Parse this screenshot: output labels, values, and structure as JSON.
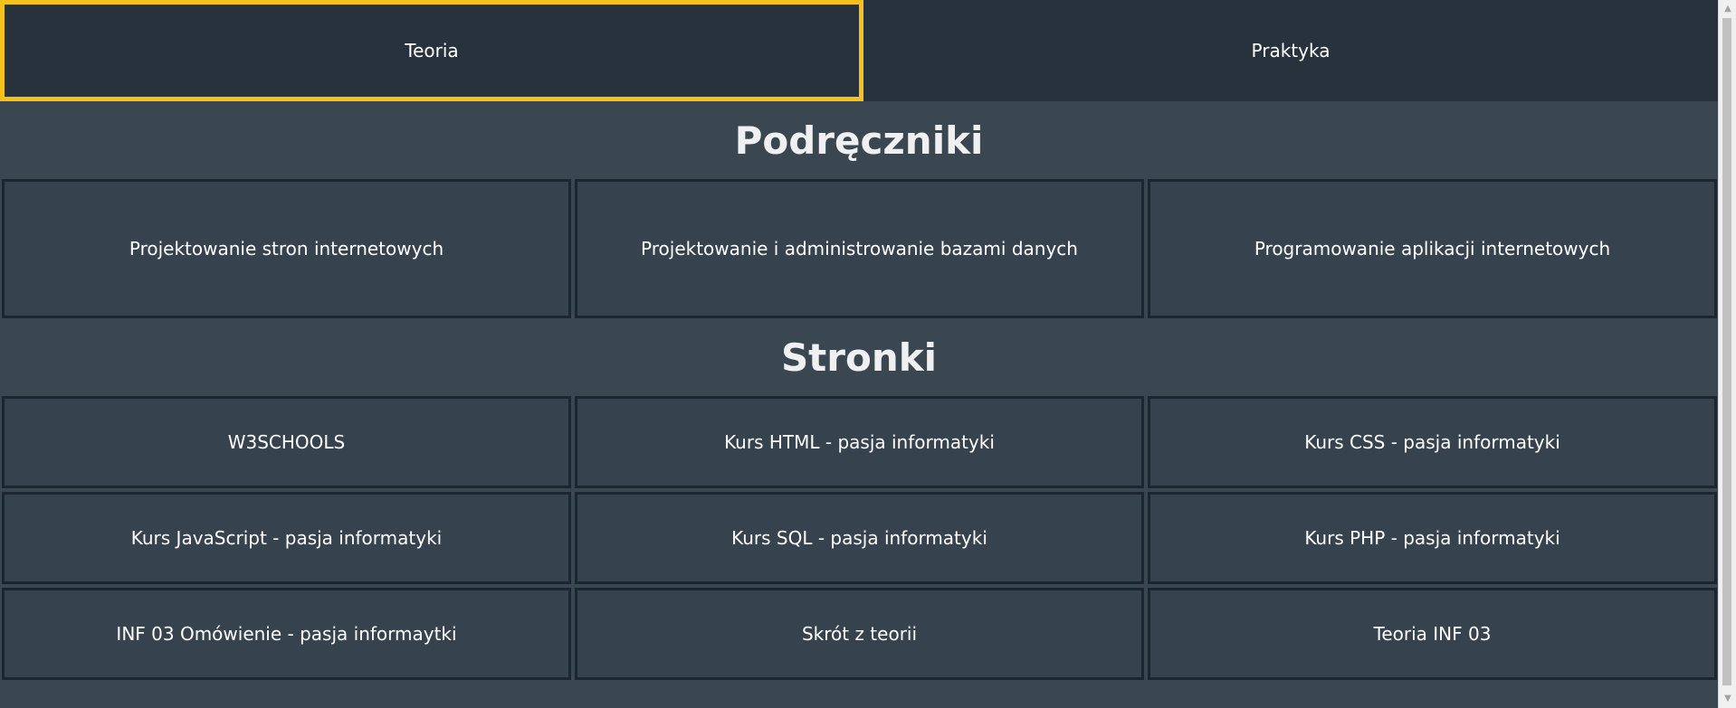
{
  "nav": {
    "tabs": [
      {
        "label": "Teoria",
        "active": true
      },
      {
        "label": "Praktyka",
        "active": false
      }
    ]
  },
  "sections": [
    {
      "title": "Podręczniki",
      "cards": [
        "Projektowanie stron internetowych",
        "Projektowanie i administrowanie bazami danych",
        "Programowanie aplikacji internetowych"
      ]
    },
    {
      "title": "Stronki",
      "cards": [
        "W3SCHOOLS",
        "Kurs HTML - pasja informatyki",
        "Kurs CSS - pasja informatyki",
        "Kurs JavaScript - pasja informatyki",
        "Kurs SQL - pasja informatyki",
        "Kurs PHP - pasja informatyki",
        "INF 03 Omówienie - pasja informaytki",
        "Skrót z teorii",
        "Teoria INF 03"
      ]
    }
  ],
  "colors": {
    "page_bg": "#3a4650",
    "nav_bg": "#27323d",
    "card_bg": "#36424d",
    "card_border": "#1b2630",
    "active_tab_border": "#f6c21a",
    "text": "#ffffff"
  },
  "scrollbar": {
    "up_icon": "triangle-up-icon",
    "down_icon": "triangle-down-icon"
  }
}
